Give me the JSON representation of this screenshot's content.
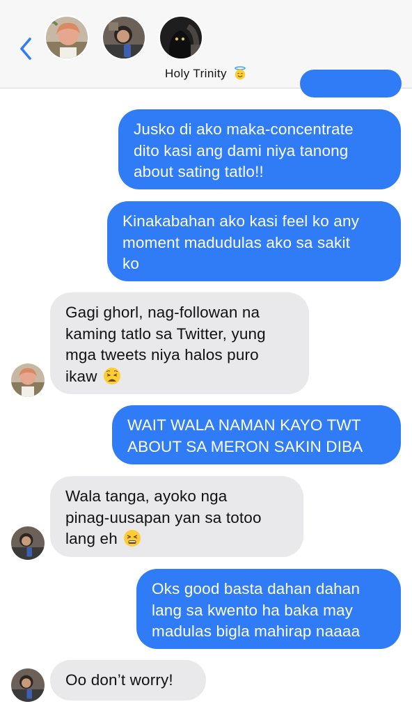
{
  "header": {
    "back_icon": "chevron-left-icon",
    "group_name": "Holy Trinity",
    "group_emoji": "smiling-face-with-halo",
    "participants": [
      "participant-1",
      "participant-2",
      "participant-3"
    ]
  },
  "messages": [
    {
      "direction": "outgoing",
      "lines": [
        "Jusko di ako maka-concentrate",
        "dito kasi ang dami niya tanong",
        "about sating tatlo!!"
      ]
    },
    {
      "direction": "outgoing",
      "lines": [
        "Kinakabahan ako kasi feel ko any",
        "moment madudulas ako sa sakit",
        "ko"
      ]
    },
    {
      "direction": "incoming",
      "lines": [
        "Gagi ghorl, nag-followan na",
        "kaming tatlo sa Twitter, yung",
        "mga tweets niya halos puro",
        "ikaw"
      ],
      "emoji": "weary-face"
    },
    {
      "direction": "outgoing",
      "lines": [
        "WAIT WALA NAMAN KAYO TWT",
        "ABOUT SA MERON SAKIN DIBA"
      ]
    },
    {
      "direction": "incoming",
      "lines": [
        "Wala tanga, ayoko nga",
        "pinag-uusapan yan sa totoo",
        "lang eh"
      ],
      "emoji": "tired-face"
    },
    {
      "direction": "outgoing",
      "lines": [
        "Oks good basta dahan dahan",
        "lang sa kwento ha baka may",
        "madulas bigla mahirap naaaa"
      ]
    },
    {
      "direction": "incoming",
      "lines": [
        "Oo don’t worry!"
      ]
    }
  ],
  "colors": {
    "outgoing_bubble": "#2f7cf6",
    "incoming_bubble": "#e9e9eb",
    "accent": "#2f7cf6",
    "header_bg": "#f7f7f7"
  }
}
